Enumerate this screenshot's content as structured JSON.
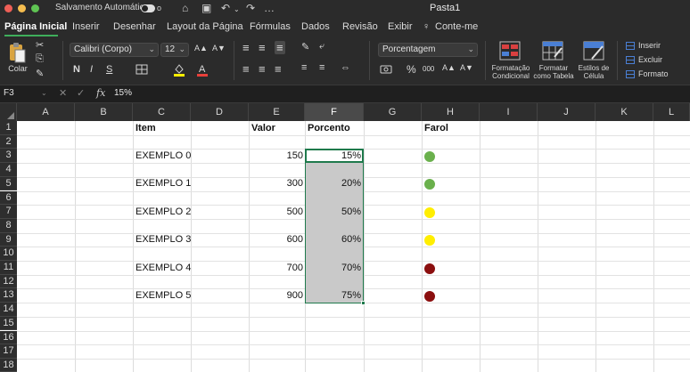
{
  "titlebar": {
    "autosave_label": "Salvamento Automático",
    "toggle_state": "o",
    "doc_title": "Pasta1"
  },
  "tabs": [
    {
      "label": "Página Inicial",
      "active": true
    },
    {
      "label": "Inserir"
    },
    {
      "label": "Desenhar"
    },
    {
      "label": "Layout da Página"
    },
    {
      "label": "Fórmulas"
    },
    {
      "label": "Dados"
    },
    {
      "label": "Revisão"
    },
    {
      "label": "Exibir"
    },
    {
      "label": "Conte-me"
    }
  ],
  "ribbon": {
    "paste_label": "Colar",
    "font_name": "Calibri (Corpo)",
    "font_size": "12",
    "bold": "N",
    "italic": "I",
    "underline": "S",
    "number_format": "Porcentagem",
    "conditional_format": "Formatação Condicional",
    "format_table": "Formatar como Tabela",
    "cell_styles": "Estilos de Célula",
    "insert": "Inserir",
    "delete": "Excluir",
    "format": "Formato",
    "percent": "%",
    "thousands": "000"
  },
  "formula_bar": {
    "name_box": "F3",
    "fx": "fx",
    "value": "15%"
  },
  "columns": [
    "A",
    "B",
    "C",
    "D",
    "E",
    "F",
    "G",
    "H",
    "I",
    "J",
    "K",
    "L"
  ],
  "selected_column": "F",
  "rows": [
    "1",
    "2",
    "3",
    "4",
    "5",
    "6",
    "7",
    "8",
    "9",
    "10",
    "11",
    "12",
    "13",
    "14",
    "15",
    "16",
    "17",
    "18"
  ],
  "headers": {
    "item": "Item",
    "valor": "Valor",
    "porcento": "Porcento",
    "farol": "Farol"
  },
  "data_rows": [
    {
      "item": "EXEMPLO 0",
      "valor": "150",
      "porcento": "15%",
      "farol_color": "#6ab04c"
    },
    {
      "item": "EXEMPLO 1",
      "valor": "300",
      "porcento": "20%",
      "farol_color": "#6ab04c"
    },
    {
      "item": "EXEMPLO 2",
      "valor": "500",
      "porcento": "50%",
      "farol_color": "#ffee00"
    },
    {
      "item": "EXEMPLO 3",
      "valor": "600",
      "porcento": "60%",
      "farol_color": "#ffee00"
    },
    {
      "item": "EXEMPLO 4",
      "valor": "700",
      "porcento": "70%",
      "farol_color": "#8b0f0f"
    },
    {
      "item": "EXEMPLO 5",
      "valor": "900",
      "porcento": "75%",
      "farol_color": "#8b0f0f"
    }
  ],
  "icons": {
    "home": "⌂",
    "save": "▣",
    "undo": "↶",
    "redo": "↷",
    "more": "…",
    "lightbulb": "♀",
    "cut": "✂",
    "copy": "⎘",
    "brush": "✎",
    "font_grow": "A▲",
    "font_shrink": "A▼",
    "align_left": "≡",
    "wrap": "⤶",
    "merge": "⇔",
    "cancel": "✕",
    "confirm": "✓",
    "chevron": "⌄"
  }
}
